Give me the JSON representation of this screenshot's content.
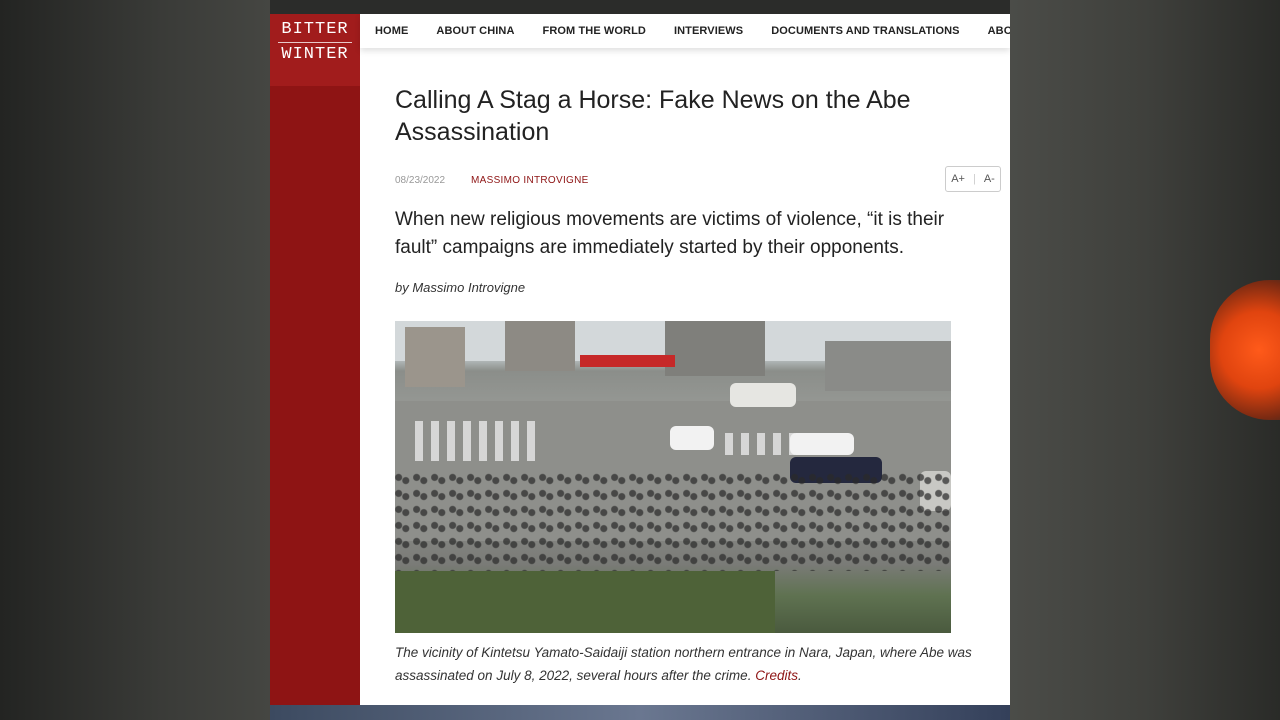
{
  "logo": {
    "line1": "BITTER",
    "line2": "WINTER"
  },
  "nav": {
    "items": [
      "HOME",
      "ABOUT CHINA",
      "FROM THE WORLD",
      "INTERVIEWS",
      "DOCUMENTS AND TRANSLATIONS",
      "ABOUT"
    ]
  },
  "article": {
    "title": "Calling A Stag a Horse: Fake News on the Abe Assassination",
    "date": "08/23/2022",
    "author": "MASSIMO INTROVIGNE",
    "font_increase": "A+",
    "font_separator": "|",
    "font_decrease": "A-",
    "lead": "When new religious movements are victims of violence, “it is their fault” campaigns are immediately started by their opponents.",
    "byline": "by Massimo Introvigne",
    "caption_text": "The vicinity of Kintetsu Yamato-Saidaiji station northern entrance in Nara, Japan, where Abe was assassinated on July 8, 2022, several hours after the crime. ",
    "caption_link": "Credits",
    "caption_end": "."
  },
  "colors": {
    "brand_red": "#8e1414",
    "logo_red": "#a11c1c"
  }
}
